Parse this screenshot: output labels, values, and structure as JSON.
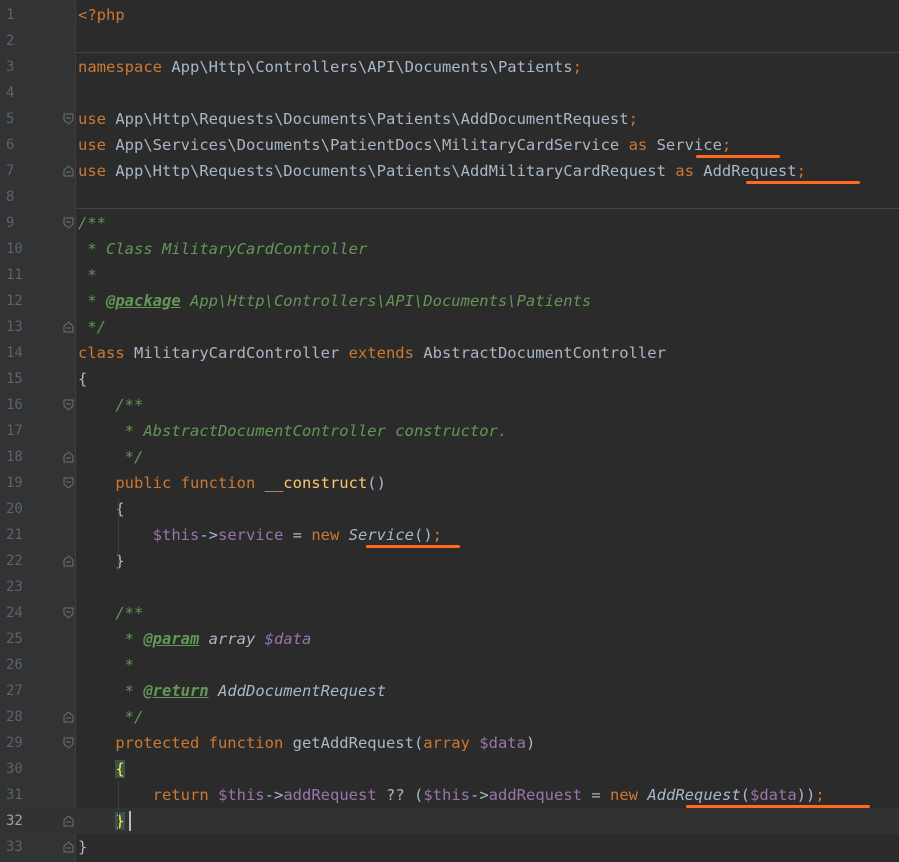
{
  "editor": {
    "current_line": 32,
    "lines": [
      {
        "n": "1",
        "tokens": [
          {
            "t": "<?php",
            "s": "k"
          }
        ]
      },
      {
        "n": "2",
        "tokens": []
      },
      {
        "n": "3",
        "tokens": [
          {
            "t": "namespace",
            "s": "k"
          },
          {
            "t": " App\\Http\\Controllers\\API\\Documents\\Patients",
            "s": "t"
          },
          {
            "t": ";",
            "s": "k"
          }
        ]
      },
      {
        "n": "4",
        "tokens": []
      },
      {
        "n": "5",
        "tokens": [
          {
            "t": "use",
            "s": "k"
          },
          {
            "t": " App\\Http\\Requests\\Documents\\Patients\\AddDocumentRequest",
            "s": "t"
          },
          {
            "t": ";",
            "s": "k"
          }
        ]
      },
      {
        "n": "6",
        "tokens": [
          {
            "t": "use",
            "s": "k"
          },
          {
            "t": " App\\Services\\Documents\\PatientDocs\\MilitaryCardService ",
            "s": "t"
          },
          {
            "t": "as",
            "s": "k"
          },
          {
            "t": " Service",
            "s": "t"
          },
          {
            "t": ";",
            "s": "k"
          }
        ]
      },
      {
        "n": "7",
        "tokens": [
          {
            "t": "use",
            "s": "k"
          },
          {
            "t": " App\\Http\\Requests\\Documents\\Patients\\AddMilitaryCardRequest ",
            "s": "t"
          },
          {
            "t": "as",
            "s": "k"
          },
          {
            "t": " AddRequest",
            "s": "t"
          },
          {
            "t": ";",
            "s": "k"
          }
        ]
      },
      {
        "n": "8",
        "tokens": []
      },
      {
        "n": "9",
        "tokens": [
          {
            "t": "/**",
            "s": "c"
          }
        ]
      },
      {
        "n": "10",
        "tokens": [
          {
            "t": " * Class MilitaryCardController",
            "s": "c"
          }
        ]
      },
      {
        "n": "11",
        "tokens": [
          {
            "t": " *",
            "s": "c"
          }
        ]
      },
      {
        "n": "12",
        "tokens": [
          {
            "t": " * ",
            "s": "c"
          },
          {
            "t": "@package",
            "s": "tag"
          },
          {
            "t": " App\\Http\\Controllers\\API\\Documents\\Patients",
            "s": "c"
          }
        ]
      },
      {
        "n": "13",
        "tokens": [
          {
            "t": " */",
            "s": "c"
          }
        ]
      },
      {
        "n": "14",
        "tokens": [
          {
            "t": "class",
            "s": "k"
          },
          {
            "t": " MilitaryCardController ",
            "s": "t"
          },
          {
            "t": "extends",
            "s": "k"
          },
          {
            "t": " AbstractDocumentController",
            "s": "t"
          }
        ]
      },
      {
        "n": "15",
        "tokens": [
          {
            "t": "{",
            "s": "t"
          }
        ]
      },
      {
        "n": "16",
        "tokens": [
          {
            "t": "    /**",
            "s": "c"
          }
        ]
      },
      {
        "n": "17",
        "tokens": [
          {
            "t": "     * AbstractDocumentController constructor.",
            "s": "c"
          }
        ]
      },
      {
        "n": "18",
        "tokens": [
          {
            "t": "     */",
            "s": "c"
          }
        ]
      },
      {
        "n": "19",
        "tokens": [
          {
            "t": "    public function ",
            "s": "k"
          },
          {
            "t": "__construct",
            "s": "f"
          },
          {
            "t": "()",
            "s": "t"
          }
        ]
      },
      {
        "n": "20",
        "tokens": [
          {
            "t": "    {",
            "s": "t"
          }
        ]
      },
      {
        "n": "21",
        "tokens": [
          {
            "t": "        ",
            "s": "t"
          },
          {
            "t": "$this",
            "s": "v"
          },
          {
            "t": "->",
            "s": "t"
          },
          {
            "t": "service",
            "s": "v"
          },
          {
            "t": " = ",
            "s": "t"
          },
          {
            "t": "new ",
            "s": "k"
          },
          {
            "t": "Service",
            "s": "ci"
          },
          {
            "t": "()",
            "s": "t"
          },
          {
            "t": ";",
            "s": "k"
          }
        ]
      },
      {
        "n": "22",
        "tokens": [
          {
            "t": "    }",
            "s": "t"
          }
        ]
      },
      {
        "n": "23",
        "tokens": []
      },
      {
        "n": "24",
        "tokens": [
          {
            "t": "    /**",
            "s": "c"
          }
        ]
      },
      {
        "n": "25",
        "tokens": [
          {
            "t": "     * ",
            "s": "c"
          },
          {
            "t": "@param",
            "s": "tag"
          },
          {
            "t": " array ",
            "s": "ci"
          },
          {
            "t": "$data",
            "s": "vi"
          }
        ]
      },
      {
        "n": "26",
        "tokens": [
          {
            "t": "     *",
            "s": "c"
          }
        ]
      },
      {
        "n": "27",
        "tokens": [
          {
            "t": "     * ",
            "s": "c"
          },
          {
            "t": "@return",
            "s": "tag"
          },
          {
            "t": " AddDocumentRequest",
            "s": "ci"
          }
        ]
      },
      {
        "n": "28",
        "tokens": [
          {
            "t": "     */",
            "s": "c"
          }
        ]
      },
      {
        "n": "29",
        "tokens": [
          {
            "t": "    protected function ",
            "s": "k"
          },
          {
            "t": "getAddRequest(",
            "s": "t"
          },
          {
            "t": "array ",
            "s": "k"
          },
          {
            "t": "$data",
            "s": "v"
          },
          {
            "t": ")",
            "s": "t"
          }
        ]
      },
      {
        "n": "30",
        "tokens": [
          {
            "t": "    ",
            "s": "t"
          },
          {
            "t": "{",
            "s": "b"
          }
        ]
      },
      {
        "n": "31",
        "tokens": [
          {
            "t": "        ",
            "s": "t"
          },
          {
            "t": "return ",
            "s": "k"
          },
          {
            "t": "$this",
            "s": "v"
          },
          {
            "t": "->",
            "s": "t"
          },
          {
            "t": "addRequest",
            "s": "v"
          },
          {
            "t": " ?? (",
            "s": "t"
          },
          {
            "t": "$this",
            "s": "v"
          },
          {
            "t": "->",
            "s": "t"
          },
          {
            "t": "addRequest",
            "s": "v"
          },
          {
            "t": " = ",
            "s": "t"
          },
          {
            "t": "new ",
            "s": "k"
          },
          {
            "t": "AddRequest",
            "s": "ci"
          },
          {
            "t": "(",
            "s": "t"
          },
          {
            "t": "$data",
            "s": "v"
          },
          {
            "t": "))",
            "s": "t"
          },
          {
            "t": ";",
            "s": "k"
          }
        ]
      },
      {
        "n": "32",
        "tokens": [
          {
            "t": "    ",
            "s": "t"
          },
          {
            "t": "}",
            "s": "b"
          }
        ]
      },
      {
        "n": "33",
        "tokens": [
          {
            "t": "}",
            "s": "t"
          }
        ]
      }
    ],
    "fold_markers": [
      {
        "line": 5,
        "kind": "open"
      },
      {
        "line": 7,
        "kind": "close"
      },
      {
        "line": 9,
        "kind": "open"
      },
      {
        "line": 13,
        "kind": "close"
      },
      {
        "line": 16,
        "kind": "open"
      },
      {
        "line": 18,
        "kind": "close"
      },
      {
        "line": 19,
        "kind": "open"
      },
      {
        "line": 22,
        "kind": "close"
      },
      {
        "line": 24,
        "kind": "open"
      },
      {
        "line": 28,
        "kind": "close"
      },
      {
        "line": 29,
        "kind": "open"
      },
      {
        "line": 32,
        "kind": "close"
      },
      {
        "line": 33,
        "kind": "close"
      }
    ],
    "highlight_color": "#ff6b1a"
  }
}
